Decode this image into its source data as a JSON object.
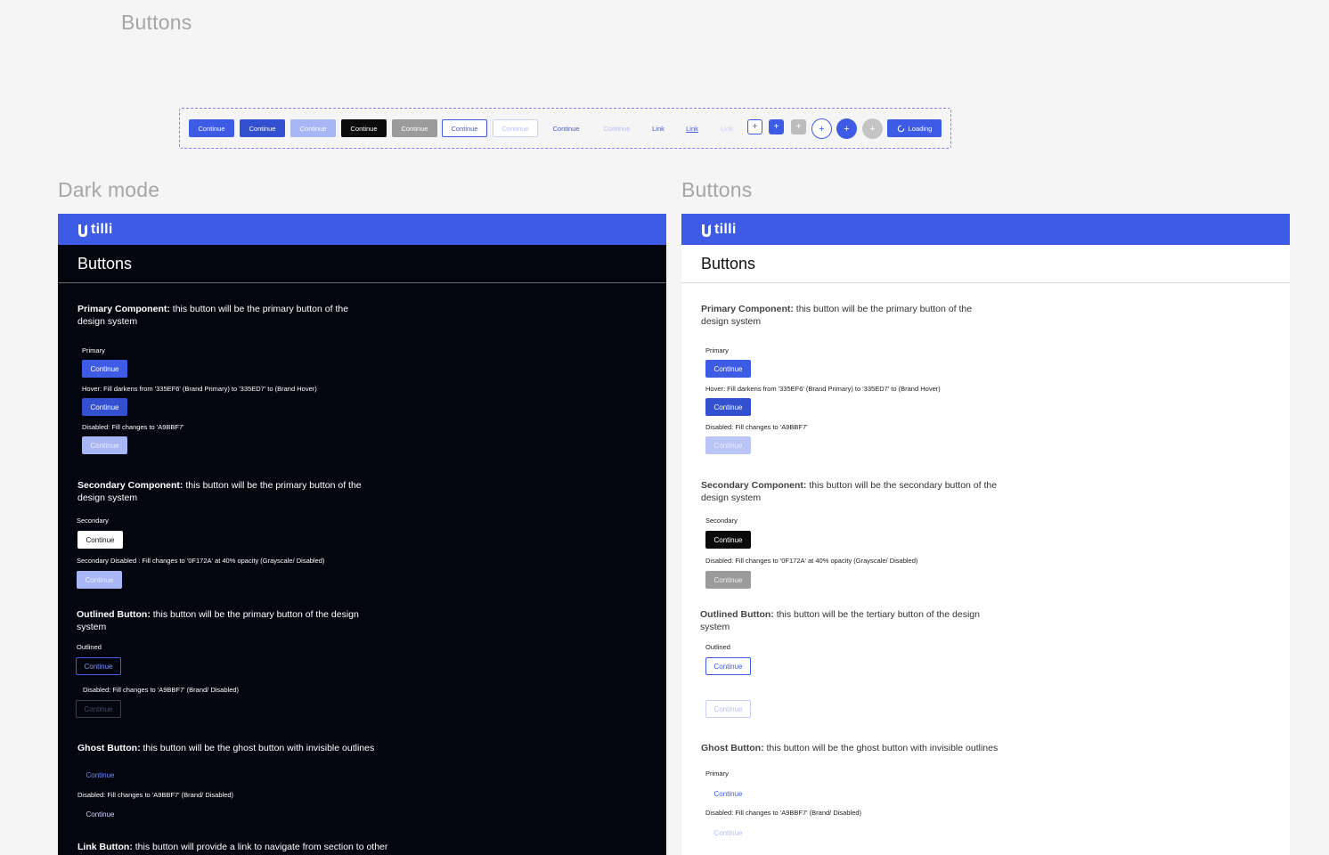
{
  "page_title": "Buttons",
  "strip": {
    "labels": [
      "Continue",
      "Continue",
      "Continue",
      "Continue",
      "Continue",
      "Continue",
      "Continue",
      "Continue",
      "Continue",
      "Link",
      "Link",
      "Link"
    ],
    "plus": "+",
    "loading": "Loading"
  },
  "dark": {
    "heading": "Dark mode",
    "brand": "tilli",
    "title": "Buttons",
    "primary": {
      "name": "Primary Component:",
      "text": " this button will be the primary button of the design system",
      "label": "Primary",
      "btn": "Continue",
      "hover": "Hover: Fill darkens from '335EF6' (Brand Primary)  to '335ED7' to (Brand Hover)",
      "disabled": "Disabled: Fill changes to 'A9BBF7'"
    },
    "secondary": {
      "name": "Secondary Component:",
      "text": " this button will be the primary button of the design system",
      "label": "Secondary",
      "btn": "Continue",
      "disabled": "Secondary Disabled : Fill changes to '0F172A' at 40% opacity (Grayscale/ Disabled)"
    },
    "outlined": {
      "name": "Outlined Button:",
      "text": " this button will be the primary button of the design system",
      "label": "Outlined",
      "btn": "Continue",
      "disabled": "Disabled: Fill changes to 'A9BBF7' (Brand/ Disabled)"
    },
    "ghost": {
      "name": "Ghost Button:",
      "text": " this  button will be the ghost button with invisible outlines",
      "btn": "Continue",
      "disabled": "Disabled: Fill changes to 'A9BBF7' (Brand/ Disabled)"
    },
    "link": {
      "name": "Link Button:",
      "text": " this  button will provide a link to navigate from section to other"
    }
  },
  "light": {
    "heading": "Buttons",
    "brand": "tilli",
    "title": "Buttons",
    "primary": {
      "name": "Primary Component:",
      "text": " this button will be the primary button of the design system",
      "label": "Primary",
      "btn": "Continue",
      "hover": "Hover: Fill darkens from '335EF6' (Brand Primary)  to '335ED7' to (Brand Hover)",
      "disabled": "Disabled: Fill changes to 'A9BBF7'"
    },
    "secondary": {
      "name": "Secondary Component:",
      "text": " this button will be the secondary button of the design system",
      "label": "Secondary",
      "btn": "Continue",
      "disabled": "Disabled: Fill changes to '0F172A' at 40% opacity (Grayscale/ Disabled)"
    },
    "outlined": {
      "name": "Outlined Button:",
      "text": " this button will be the tertiary button of the design system",
      "label": "Outlined",
      "btn": "Continue"
    },
    "ghost": {
      "name": "Ghost Button:",
      "text": " this  button will be the ghost button with invisible outlines",
      "label": "Primary",
      "btn": "Continue",
      "disabled": "Disabled: Fill changes to 'A9BBF7' (Brand/ Disabled)"
    }
  },
  "colors": {
    "brand": "#3E5BE6",
    "hover": "#3250D0",
    "disabled": "#A9B6F6",
    "dark_bg": "#04060F"
  }
}
